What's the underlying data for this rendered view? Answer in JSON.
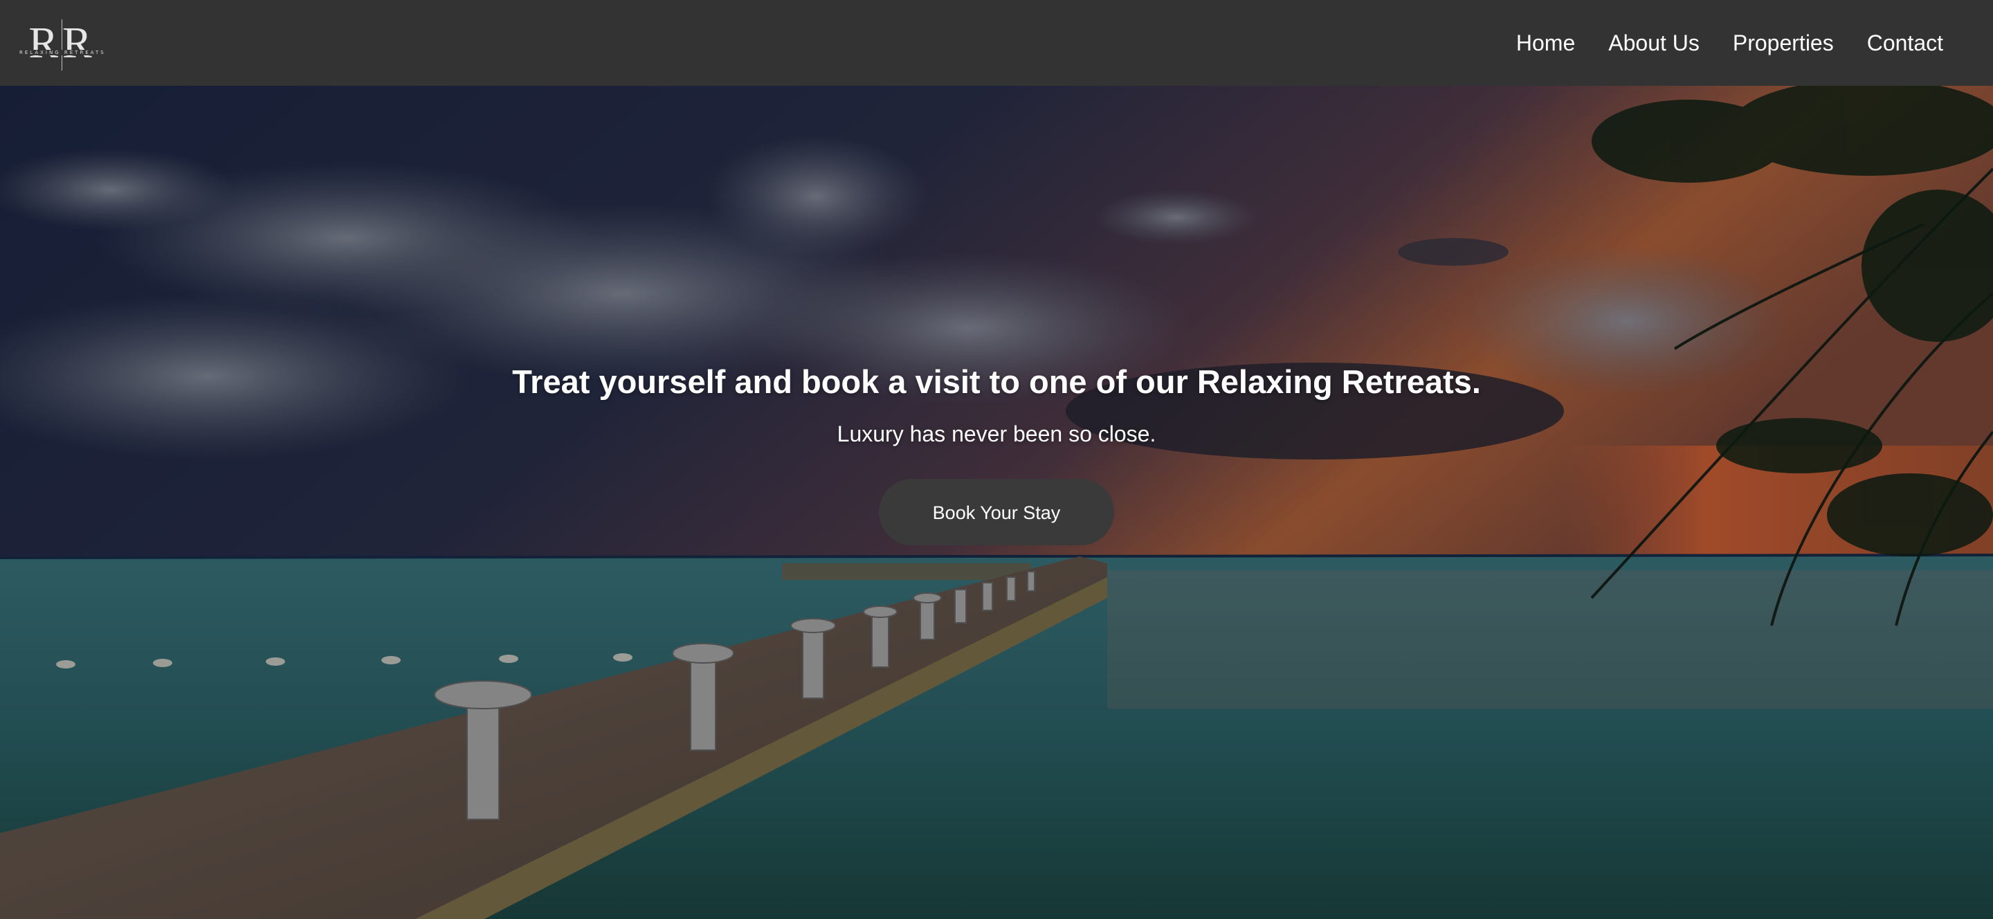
{
  "brand": {
    "logo_letters": "RR",
    "logo_subtitle": "RELAXING RETREATS"
  },
  "nav": {
    "items": [
      {
        "label": "Home"
      },
      {
        "label": "About Us"
      },
      {
        "label": "Properties"
      },
      {
        "label": "Contact"
      }
    ]
  },
  "hero": {
    "title": "Treat yourself and book a visit to one of our Relaxing Retreats.",
    "subtitle": "Luxury has never been so close.",
    "cta_label": "Book Your Stay",
    "background_image": "sunset-pier-ocean-image"
  },
  "colors": {
    "navbar_bg": "#333333",
    "button_bg": "#3a3a3a",
    "text": "#ffffff"
  }
}
